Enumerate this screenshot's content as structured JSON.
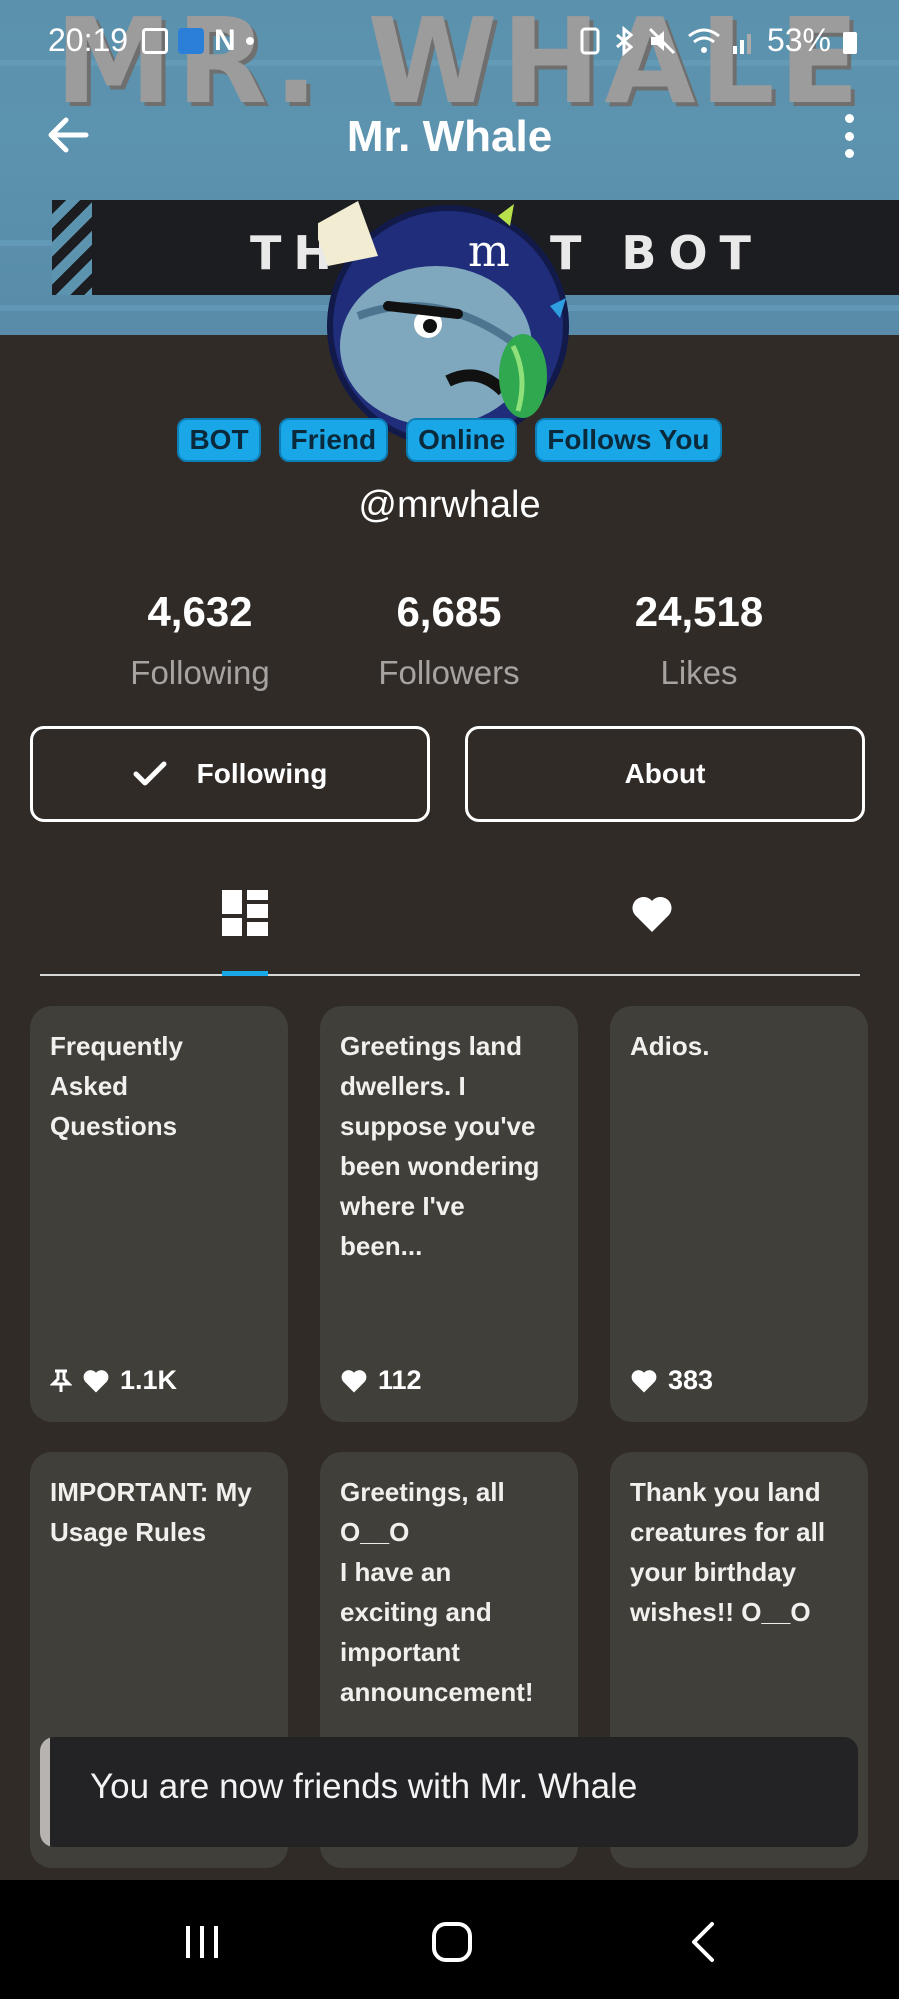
{
  "status": {
    "time": "20:19",
    "battery": "53%"
  },
  "banner": {
    "big_text": "MR. WHALE",
    "band_text_left": "TH",
    "band_text_right": "T BOT"
  },
  "header": {
    "title": "Mr. Whale"
  },
  "profile": {
    "badges": [
      "BOT",
      "Friend",
      "Online",
      "Follows You"
    ],
    "handle": "@mrwhale",
    "stats": [
      {
        "value": "4,632",
        "label": "Following"
      },
      {
        "value": "6,685",
        "label": "Followers"
      },
      {
        "value": "24,518",
        "label": "Likes"
      }
    ],
    "following_button": "Following",
    "about_button": "About"
  },
  "posts": [
    {
      "text": "Frequently\nAsked\nQuestions",
      "likes": "1.1K",
      "pinned": true
    },
    {
      "text": "Greetings land\ndwellers. I\nsuppose you've\nbeen wondering\nwhere I've\nbeen...",
      "likes": "112"
    },
    {
      "text": "Adios.",
      "likes": "383"
    },
    {
      "text": "IMPORTANT: My\nUsage Rules"
    },
    {
      "text": "Greetings, all\nO__O\nI have an\nexciting and\nimportant\nannouncement!"
    },
    {
      "text": "Thank you land\ncreatures for all\nyour birthday\nwishes!! O__O"
    }
  ],
  "toast": {
    "message": "You are now friends with Mr. Whale"
  },
  "colors": {
    "accent": "#1aa7e8",
    "background": "#312b28",
    "card": "#403f3a"
  }
}
